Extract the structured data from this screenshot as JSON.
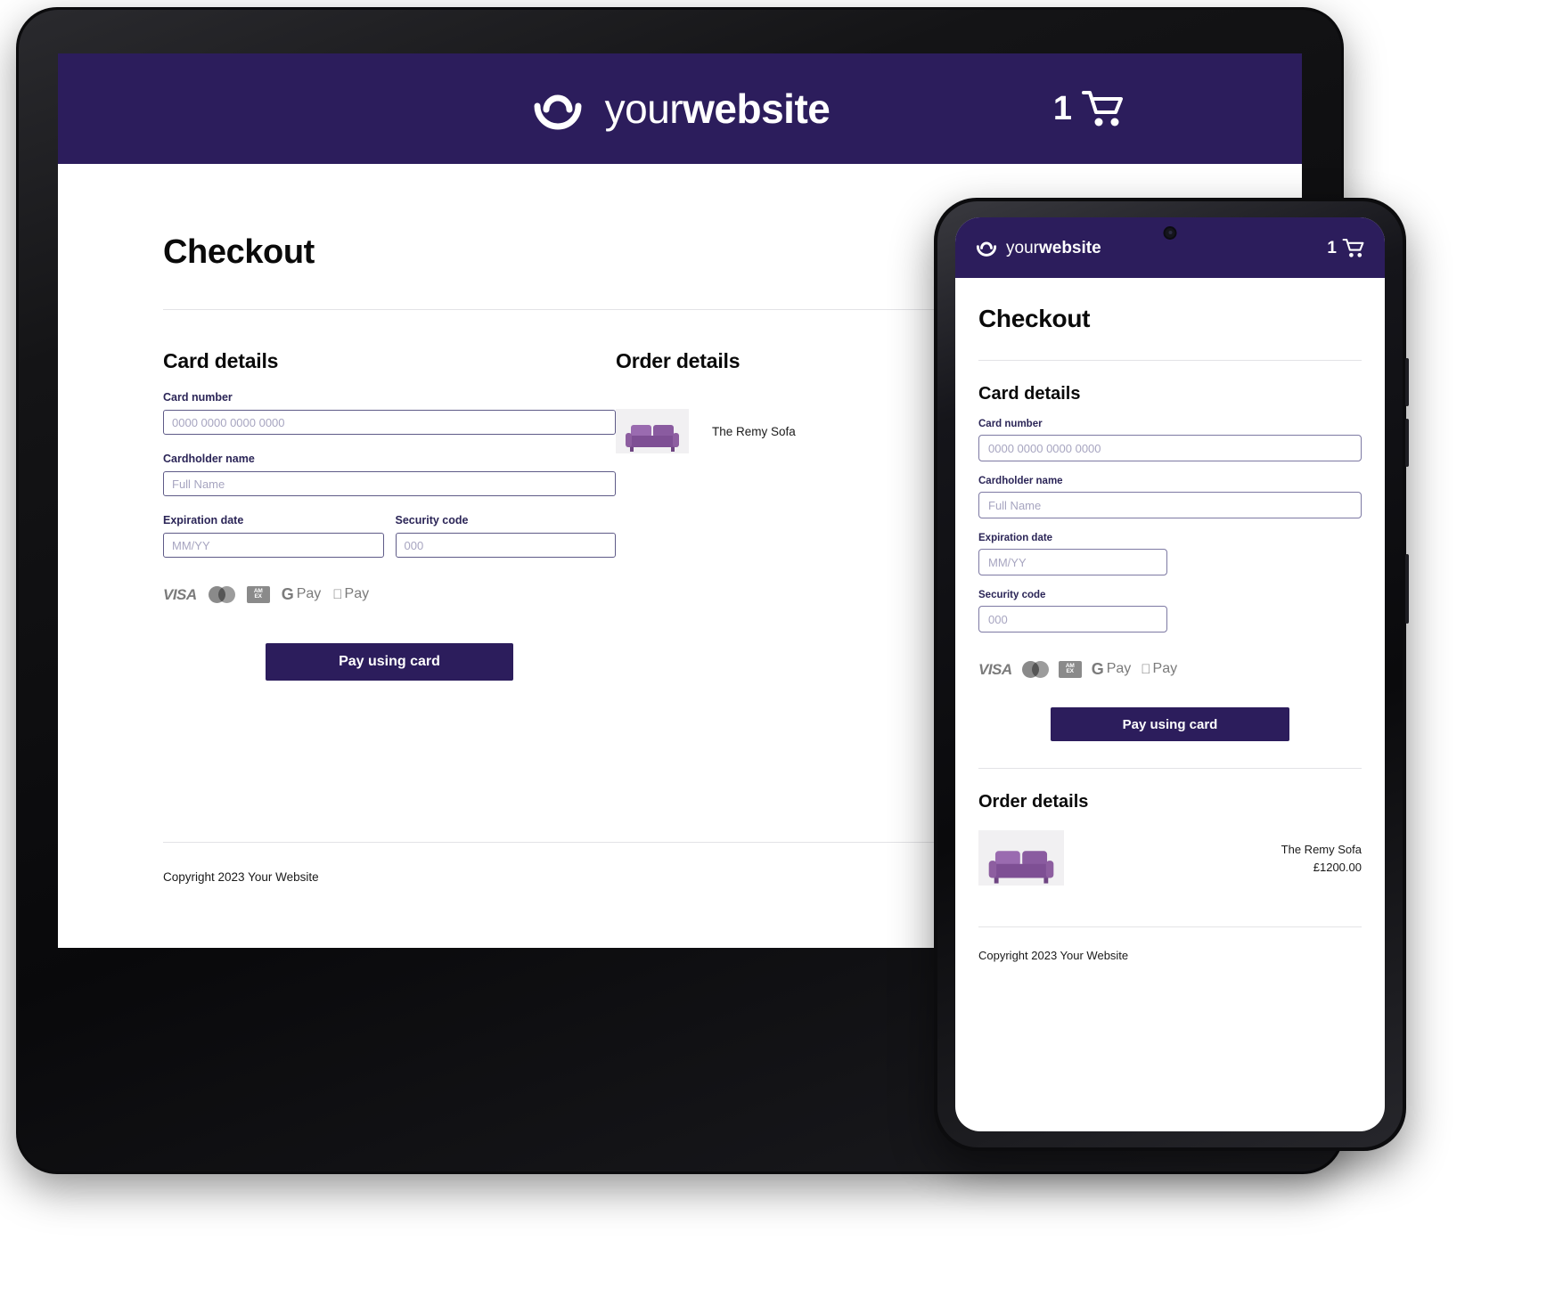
{
  "brand": {
    "name_light": "your",
    "name_bold": "website",
    "logo_icon": "smile-bowl-logo-icon"
  },
  "header": {
    "cart_count": "1",
    "cart_icon": "shopping-cart-icon"
  },
  "page": {
    "title": "Checkout"
  },
  "card_section": {
    "title": "Card details",
    "fields": {
      "card_number": {
        "label": "Card number",
        "placeholder": "0000 0000 0000 0000",
        "value": ""
      },
      "cardholder_name": {
        "label": "Cardholder name",
        "placeholder": "Full Name",
        "value": ""
      },
      "expiration_date": {
        "label": "Expiration date",
        "placeholder": "MM/YY",
        "value": ""
      },
      "security_code": {
        "label": "Security code",
        "placeholder": "000",
        "value": ""
      }
    },
    "payment_logos": [
      {
        "name": "visa-icon",
        "label": "VISA"
      },
      {
        "name": "mastercard-icon",
        "label": ""
      },
      {
        "name": "amex-icon",
        "label": "AMEX"
      },
      {
        "name": "google-pay-icon",
        "label": "G Pay"
      },
      {
        "name": "apple-pay-icon",
        "label": "Pay"
      }
    ],
    "pay_button": "Pay using card"
  },
  "order_section": {
    "title": "Order details",
    "items": [
      {
        "name": "The Remy Sofa",
        "price": "£1200.00",
        "thumb_icon": "purple-sofa-image"
      }
    ]
  },
  "footer": {
    "copyright": "Copyright 2023 Your Website"
  },
  "colors": {
    "brand_purple": "#2c1d5c",
    "field_border": "#5e5a87",
    "placeholder": "#a7a5c0",
    "label": "#2b2557",
    "sofa_purple": "#8d5ea0"
  }
}
